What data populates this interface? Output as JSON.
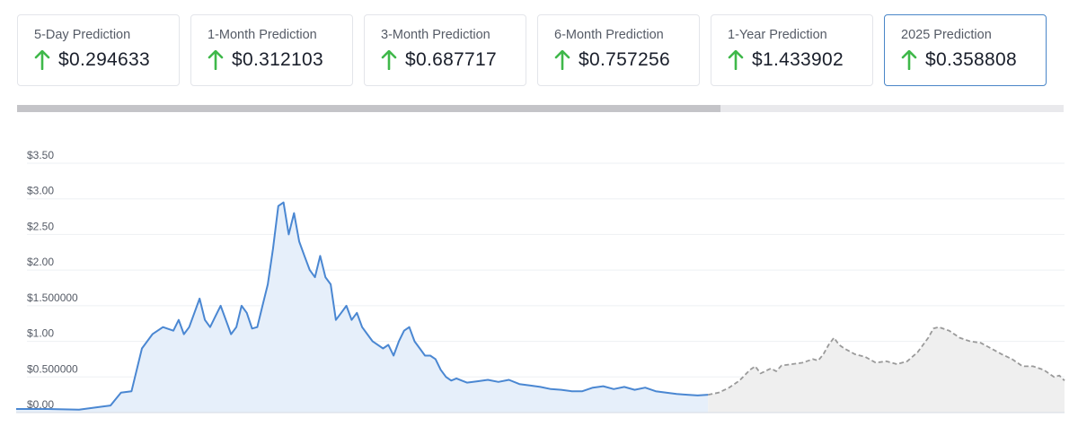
{
  "cards": [
    {
      "label": "5-Day Prediction",
      "value": "$0.294633"
    },
    {
      "label": "1-Month Prediction",
      "value": "$0.312103"
    },
    {
      "label": "3-Month Prediction",
      "value": "$0.687717"
    },
    {
      "label": "6-Month Prediction",
      "value": "$0.757256"
    },
    {
      "label": "1-Year Prediction",
      "value": "$1.433902"
    },
    {
      "label": "2025 Prediction",
      "value": "$0.358808"
    }
  ],
  "colors": {
    "up_arrow": "#3fb84a",
    "history_line": "#4a87d2",
    "history_fill": "#e6effa",
    "forecast_line": "#9a9a9a",
    "forecast_fill": "#efefef",
    "active_card_border": "#4a86c8"
  },
  "chart_data": {
    "type": "area",
    "title": "",
    "xlabel": "",
    "ylabel": "",
    "ylim": [
      0,
      3.5
    ],
    "y_ticks": [
      {
        "value": 0,
        "label": "$0.00"
      },
      {
        "value": 0.5,
        "label": "$0.500000"
      },
      {
        "value": 1.0,
        "label": "$1.00"
      },
      {
        "value": 1.5,
        "label": "$1.500000"
      },
      {
        "value": 2.0,
        "label": "$2.00"
      },
      {
        "value": 2.5,
        "label": "$2.50"
      },
      {
        "value": 3.0,
        "label": "$3.00"
      },
      {
        "value": 3.5,
        "label": "$3.50"
      }
    ],
    "x_range": [
      0,
      100
    ],
    "grid": true,
    "series": [
      {
        "kind": "historical",
        "points": [
          [
            0,
            0.05
          ],
          [
            3,
            0.05
          ],
          [
            6,
            0.04
          ],
          [
            8,
            0.08
          ],
          [
            9,
            0.1
          ],
          [
            10,
            0.28
          ],
          [
            11,
            0.3
          ],
          [
            12,
            0.9
          ],
          [
            13,
            1.1
          ],
          [
            14,
            1.2
          ],
          [
            15,
            1.15
          ],
          [
            15.5,
            1.3
          ],
          [
            16,
            1.1
          ],
          [
            16.5,
            1.2
          ],
          [
            17,
            1.4
          ],
          [
            17.5,
            1.6
          ],
          [
            18,
            1.3
          ],
          [
            18.5,
            1.2
          ],
          [
            19,
            1.35
          ],
          [
            19.5,
            1.5
          ],
          [
            20,
            1.3
          ],
          [
            20.5,
            1.1
          ],
          [
            21,
            1.2
          ],
          [
            21.5,
            1.5
          ],
          [
            22,
            1.4
          ],
          [
            22.5,
            1.18
          ],
          [
            23,
            1.2
          ],
          [
            23.5,
            1.5
          ],
          [
            24,
            1.8
          ],
          [
            24.5,
            2.3
          ],
          [
            25,
            2.9
          ],
          [
            25.5,
            2.95
          ],
          [
            26,
            2.5
          ],
          [
            26.5,
            2.8
          ],
          [
            27,
            2.4
          ],
          [
            27.5,
            2.2
          ],
          [
            28,
            2.0
          ],
          [
            28.5,
            1.9
          ],
          [
            29,
            2.2
          ],
          [
            29.5,
            1.9
          ],
          [
            30,
            1.8
          ],
          [
            30.5,
            1.3
          ],
          [
            31,
            1.4
          ],
          [
            31.5,
            1.5
          ],
          [
            32,
            1.3
          ],
          [
            32.5,
            1.4
          ],
          [
            33,
            1.2
          ],
          [
            33.5,
            1.1
          ],
          [
            34,
            1.0
          ],
          [
            35,
            0.9
          ],
          [
            35.5,
            0.95
          ],
          [
            36,
            0.8
          ],
          [
            36.5,
            1.0
          ],
          [
            37,
            1.15
          ],
          [
            37.5,
            1.2
          ],
          [
            38,
            1.0
          ],
          [
            38.5,
            0.9
          ],
          [
            39,
            0.8
          ],
          [
            39.5,
            0.8
          ],
          [
            40,
            0.75
          ],
          [
            40.5,
            0.6
          ],
          [
            41,
            0.5
          ],
          [
            41.5,
            0.45
          ],
          [
            42,
            0.48
          ],
          [
            42.5,
            0.45
          ],
          [
            43,
            0.42
          ],
          [
            44,
            0.44
          ],
          [
            45,
            0.46
          ],
          [
            46,
            0.43
          ],
          [
            47,
            0.46
          ],
          [
            48,
            0.4
          ],
          [
            49,
            0.38
          ],
          [
            50,
            0.36
          ],
          [
            51,
            0.33
          ],
          [
            52,
            0.32
          ],
          [
            53,
            0.3
          ],
          [
            54,
            0.3
          ],
          [
            55,
            0.35
          ],
          [
            56,
            0.37
          ],
          [
            57,
            0.33
          ],
          [
            58,
            0.36
          ],
          [
            59,
            0.32
          ],
          [
            60,
            0.35
          ],
          [
            61,
            0.3
          ],
          [
            62,
            0.28
          ],
          [
            63,
            0.26
          ],
          [
            64,
            0.25
          ],
          [
            65,
            0.24
          ],
          [
            66,
            0.25
          ]
        ]
      },
      {
        "kind": "forecast",
        "points": [
          [
            66,
            0.25
          ],
          [
            67,
            0.28
          ],
          [
            68,
            0.35
          ],
          [
            69,
            0.45
          ],
          [
            70,
            0.6
          ],
          [
            70.5,
            0.65
          ],
          [
            71,
            0.55
          ],
          [
            72,
            0.62
          ],
          [
            72.5,
            0.58
          ],
          [
            73,
            0.66
          ],
          [
            74,
            0.68
          ],
          [
            75,
            0.7
          ],
          [
            76,
            0.75
          ],
          [
            76.5,
            0.73
          ],
          [
            77,
            0.82
          ],
          [
            77.5,
            0.95
          ],
          [
            78,
            1.05
          ],
          [
            78.5,
            0.95
          ],
          [
            79,
            0.9
          ],
          [
            80,
            0.82
          ],
          [
            81,
            0.78
          ],
          [
            82,
            0.7
          ],
          [
            83,
            0.72
          ],
          [
            84,
            0.68
          ],
          [
            85,
            0.72
          ],
          [
            86,
            0.85
          ],
          [
            86.5,
            0.95
          ],
          [
            87,
            1.05
          ],
          [
            87.5,
            1.18
          ],
          [
            88,
            1.2
          ],
          [
            89,
            1.15
          ],
          [
            90,
            1.05
          ],
          [
            91,
            1.0
          ],
          [
            92,
            0.98
          ],
          [
            93,
            0.9
          ],
          [
            94,
            0.82
          ],
          [
            95,
            0.75
          ],
          [
            96,
            0.65
          ],
          [
            97,
            0.65
          ],
          [
            98,
            0.6
          ],
          [
            99,
            0.5
          ],
          [
            99.5,
            0.52
          ],
          [
            100,
            0.45
          ]
        ]
      }
    ]
  }
}
